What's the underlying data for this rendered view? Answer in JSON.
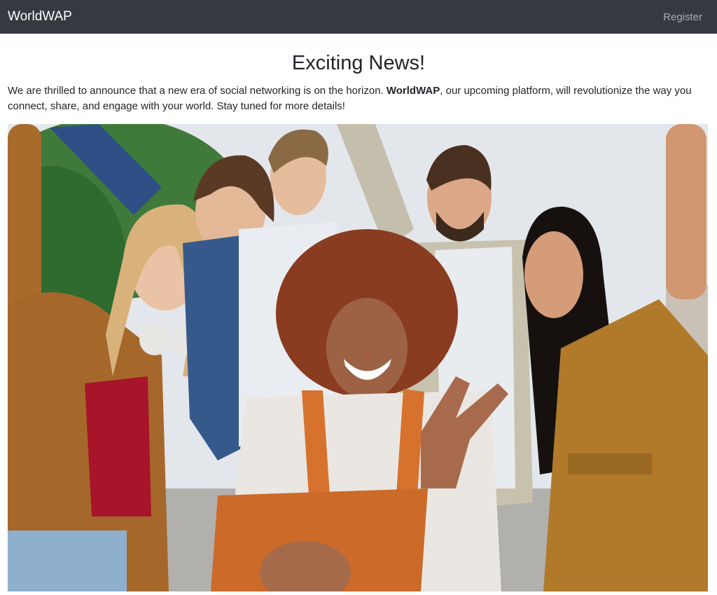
{
  "nav": {
    "brand": "WorldWAP",
    "register_label": "Register"
  },
  "main": {
    "title": "Exciting News!",
    "intro_before": "We are thrilled to announce that a new era of social networking is on the horizon. ",
    "intro_strong": "WorldWAP",
    "intro_after": ", our upcoming platform, will revolutionize the way you connect, share, and engage with your world. Stay tuned for more details!"
  },
  "colors": {
    "navbar_bg": "#343a40",
    "brand_text": "#ffffff",
    "nav_link_text": "#a9adb2",
    "body_text": "#212529"
  }
}
